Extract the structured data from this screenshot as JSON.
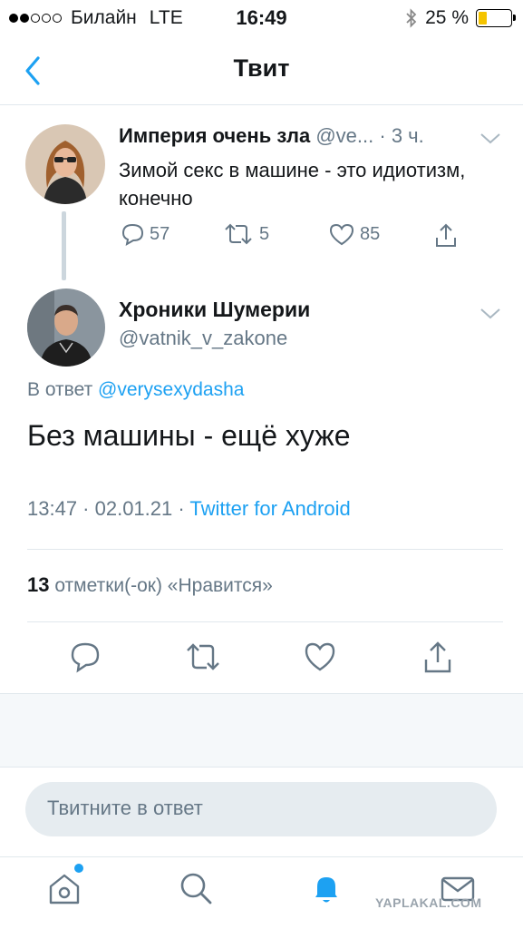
{
  "status_bar": {
    "carrier": "Билайн",
    "network": "LTE",
    "time": "16:49",
    "battery_percent": "25 %",
    "battery_level": 0.25
  },
  "nav": {
    "title": "Твит"
  },
  "original_tweet": {
    "author_name": "Империя очень зла",
    "handle_truncated": "@ve...",
    "separator": "·",
    "age": "3 ч.",
    "text": "Зимой секс в машине - это идиотизм, конечно",
    "replies": "57",
    "retweets": "5",
    "likes": "85"
  },
  "reply_tweet": {
    "author_name": "Хроники Шумерии",
    "handle": "@vatnik_v_zakone",
    "in_reply_prefix": "В ответ",
    "in_reply_handle": "@verysexydasha",
    "text": "Без машины - ещё хуже",
    "time_date": "13:47 · 02.01.21 ·",
    "source": "Twitter for Android",
    "likes_count": "13",
    "likes_label": "отметки(-ок) «Нравится»"
  },
  "compose": {
    "placeholder": "Твитните в ответ"
  },
  "watermark": "YAPLAKAL.COM",
  "colors": {
    "accent": "#1da1f2",
    "secondary_text": "#657786",
    "divider": "#e1e8ed"
  }
}
